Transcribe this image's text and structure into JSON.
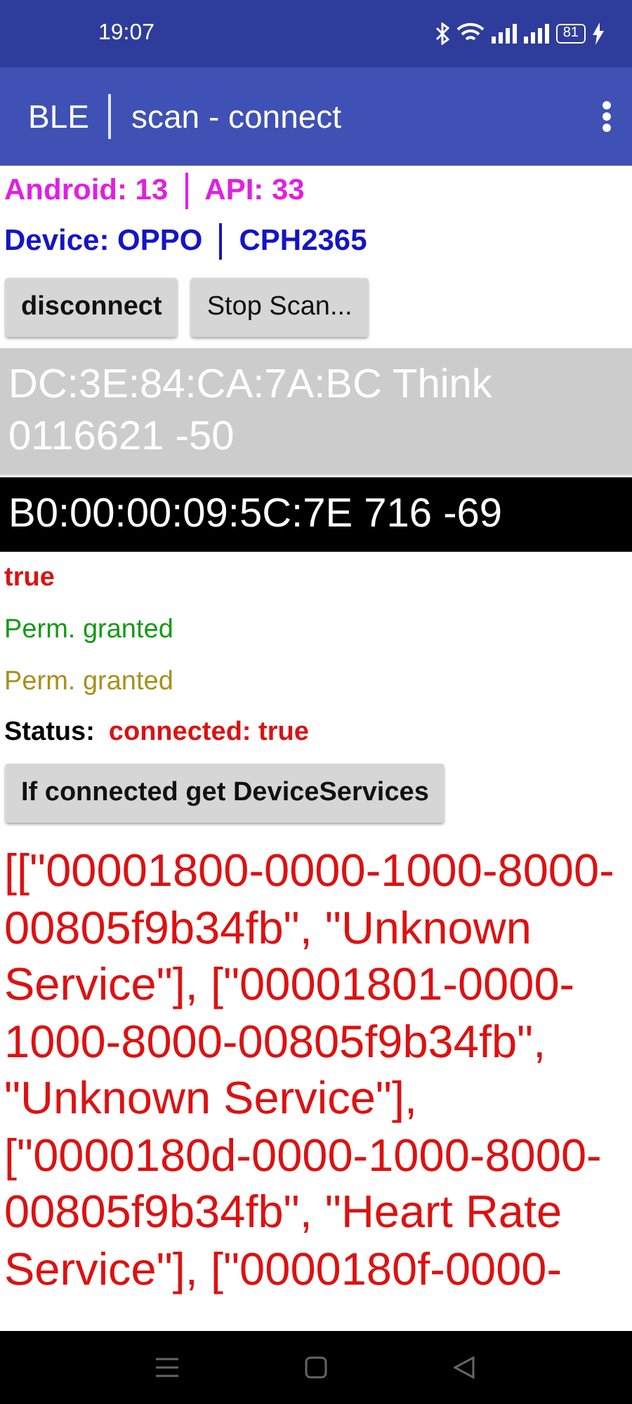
{
  "status_bar": {
    "time": "19:07",
    "battery": "81"
  },
  "app_bar": {
    "title": "BLE",
    "subtitle": "scan - connect"
  },
  "info": [
    {
      "label": "Android:  13",
      "value": "API: 33",
      "color": "#e020e0"
    },
    {
      "label": "Device: OPPO",
      "value": "CPH2365",
      "color": "#1414c8"
    }
  ],
  "buttons": [
    {
      "label": "disconnect",
      "bold": true
    },
    {
      "label": "Stop Scan...",
      "bold": false
    }
  ],
  "devices": [
    {
      "text": "DC:3E:84:CA:7A:BC Think 0116621 -50",
      "selected": false
    },
    {
      "text": "B0:00:00:09:5C:7E 716 -69",
      "selected": true
    }
  ],
  "messages": [
    {
      "text": "true",
      "color": "#dd1111",
      "bold": true
    },
    {
      "text": "Perm. granted",
      "color": "#159a15",
      "bold": false
    },
    {
      "text": "Perm. granted",
      "color": "#a8901c",
      "bold": false
    }
  ],
  "status": {
    "label": "Status:",
    "value": "connected: true"
  },
  "services_button": "If connected get DeviceServices",
  "services_text": "[[\"00001800-0000-1000-8000-00805f9b34fb\", \"Unknown Service\"], [\"00001801-0000-1000-8000-00805f9b34fb\", \"Unknown Service\"], [\"0000180d-0000-1000-8000-00805f9b34fb\", \"Heart Rate Service\"], [\"0000180f-0000-"
}
